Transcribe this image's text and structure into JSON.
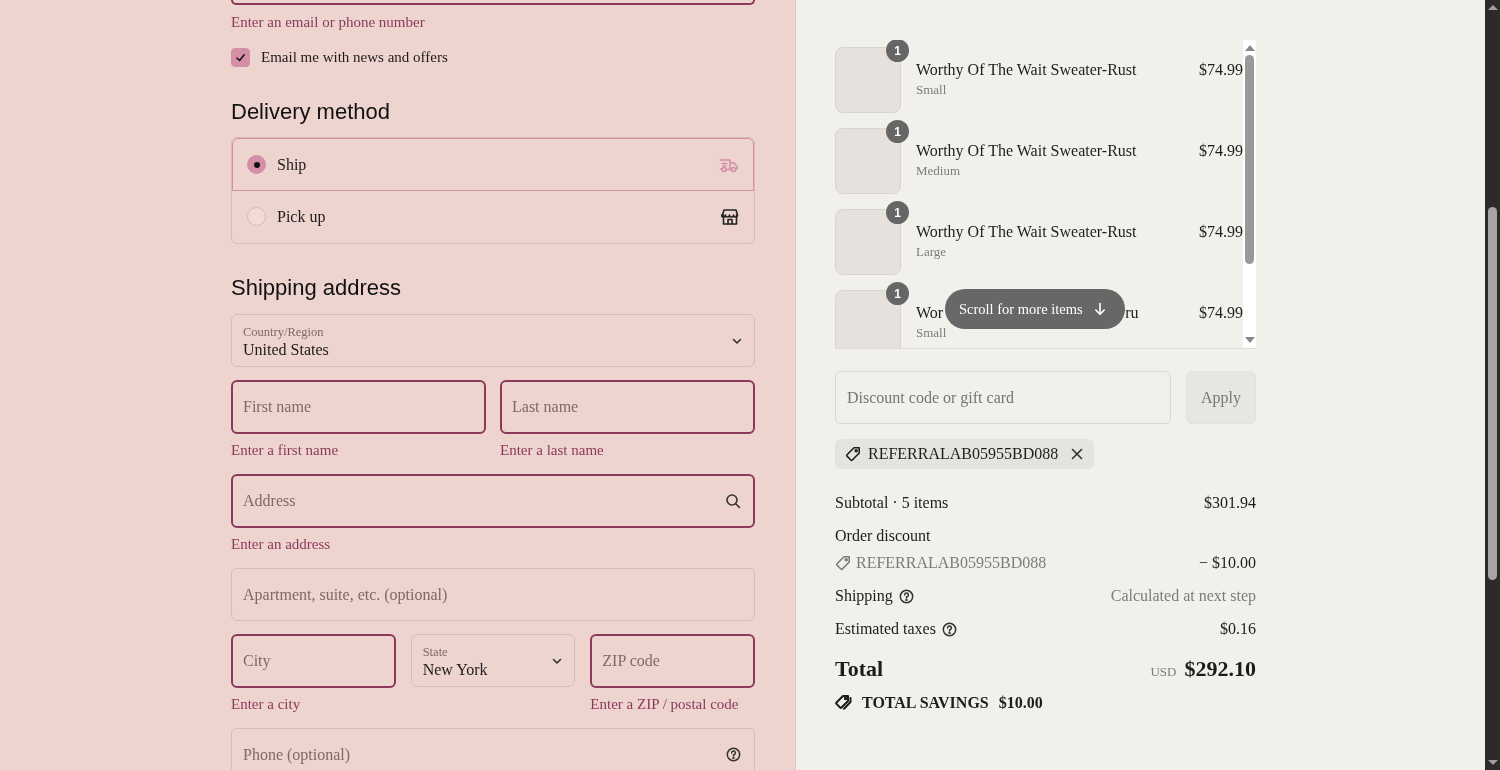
{
  "contact": {
    "email_error": "Enter an email or phone number",
    "newsletter": {
      "label": "Email me with news and offers",
      "checked": true
    }
  },
  "delivery": {
    "heading": "Delivery method",
    "options": [
      {
        "kind": "ship",
        "label": "Ship",
        "selected": true
      },
      {
        "kind": "pickup",
        "label": "Pick up",
        "selected": false
      }
    ]
  },
  "shipping_address": {
    "heading": "Shipping address",
    "rows": [
      [
        {
          "kind": "select",
          "label": "Country/Region",
          "value": "United States"
        }
      ],
      [
        {
          "kind": "text",
          "placeholder": "First name",
          "invalid": true,
          "error": "Enter a first name"
        },
        {
          "kind": "text",
          "placeholder": "Last name",
          "invalid": true,
          "error": "Enter a last name"
        }
      ],
      [
        {
          "kind": "search",
          "placeholder": "Address",
          "invalid": true,
          "error": "Enter an address"
        }
      ],
      [
        {
          "kind": "text",
          "placeholder": "Apartment, suite, etc. (optional)",
          "invalid": false
        }
      ],
      [
        {
          "kind": "text",
          "placeholder": "City",
          "invalid": true,
          "error": "Enter a city"
        },
        {
          "kind": "select",
          "label": "State",
          "value": "New York"
        },
        {
          "kind": "text",
          "placeholder": "ZIP code",
          "invalid": true,
          "error": "Enter a ZIP / postal code"
        }
      ],
      [
        {
          "kind": "help",
          "placeholder": "Phone (optional)",
          "invalid": false
        }
      ]
    ]
  },
  "order_summary": {
    "items": [
      {
        "quantity": "1",
        "name": "Worthy Of The Wait Sweater-Rust",
        "variant": "Small",
        "price": "$74.99"
      },
      {
        "quantity": "1",
        "name": "Worthy Of The Wait Sweater-Rust",
        "variant": "Medium",
        "price": "$74.99"
      },
      {
        "quantity": "1",
        "name": "Worthy Of The Wait Sweater-Rust",
        "variant": "Large",
        "price": "$74.99"
      },
      {
        "quantity": "1",
        "name_start": "Wor",
        "name_end": "ru",
        "variant": "Small",
        "price": "$74.99"
      }
    ],
    "scroll_hint": "Scroll for more items",
    "discount": {
      "placeholder": "Discount code or gift card",
      "button": "Apply"
    },
    "applied_code": "REFERRALAB05955BD088",
    "rows": [
      {
        "kind": "plain",
        "label": "Subtotal · 5 items",
        "value": "$301.94",
        "muted": false
      },
      {
        "kind": "heading",
        "label": "Order discount",
        "muted": false
      },
      {
        "kind": "code",
        "label": "REFERRALAB05955BD088",
        "value": "− $10.00",
        "muted": false
      },
      {
        "kind": "help",
        "label": "Shipping",
        "value": "Calculated at next step",
        "muted": true
      },
      {
        "kind": "help",
        "label": "Estimated taxes",
        "value": "$0.16",
        "muted": false
      }
    ],
    "total": {
      "label": "Total",
      "currency": "USD",
      "amount": "$292.10"
    },
    "savings": {
      "label": "TOTAL SAVINGS",
      "amount": "$10.00"
    }
  }
}
